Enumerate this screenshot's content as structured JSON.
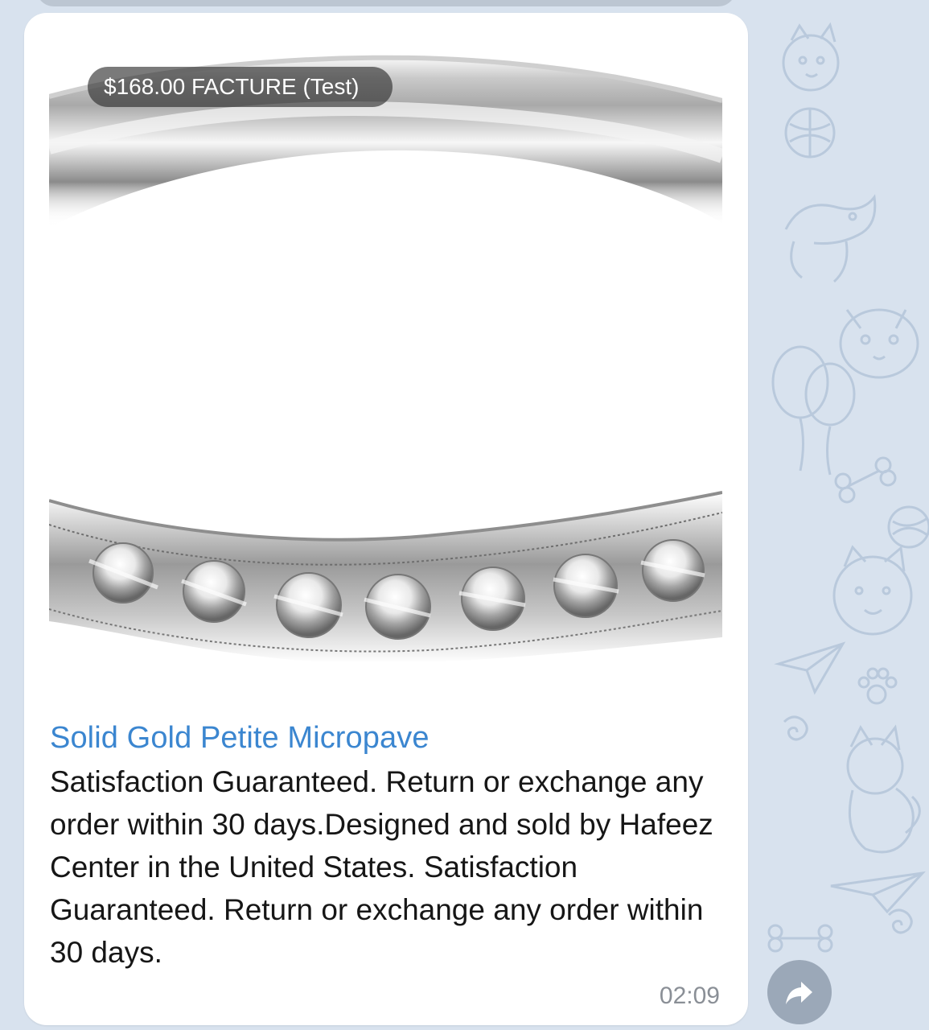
{
  "message": {
    "price_badge": "$168.00 FACTURE (Test)",
    "title": "Solid Gold Petite Micropave",
    "description": "Satisfaction Guaranteed. Return or exchange any order within 30 days.Designed and sold by Hafeez Center in the United States. Satisfaction Guaranteed. Return or exchange any order within 30 days.",
    "time": "02:09",
    "image_icon": "ring-photo"
  },
  "actions": {
    "forward_icon": "forward-arrow-icon"
  },
  "colors": {
    "background": "#d8e2ee",
    "bubble": "#ffffff",
    "title": "#3b86d0",
    "text": "#161616",
    "timestamp": "#8a8f96",
    "badge": "#282828"
  }
}
